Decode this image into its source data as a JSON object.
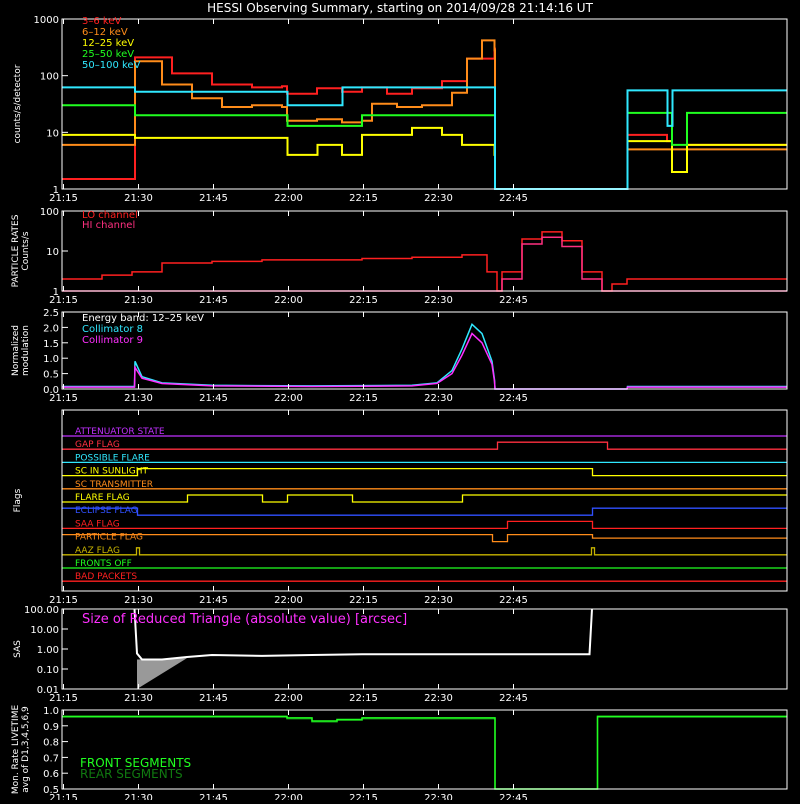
{
  "title": "HESSI Observing Summary, starting on 2014/09/28 21:14:16 UT",
  "time_ticks": [
    "21:15",
    "21:30",
    "21:45",
    "22:00",
    "22:15",
    "22:30",
    "22:45"
  ],
  "chart_data": [
    {
      "type": "line",
      "name": "count-rates",
      "ylabel": "counts/s/detector",
      "yscale": "log",
      "ylim": [
        1,
        1000
      ],
      "ytick_labels": [
        "1",
        "10",
        "100",
        "1000"
      ],
      "ytick_values": [
        1,
        10,
        100,
        1000
      ],
      "x_unit": "minutes after 21:15",
      "legend_placement": "top-left",
      "series": [
        {
          "name": "3–6 keV",
          "color": "#ff2020",
          "x": [
            0,
            14.5,
            14.6,
            22,
            30,
            38,
            44,
            45,
            51,
            56,
            60,
            65,
            70,
            76,
            81,
            86.5,
            86.6,
            113,
            113.1,
            121,
            122,
            125,
            145
          ],
          "values": [
            1.5,
            1.5,
            210,
            110,
            70,
            62,
            65,
            48,
            60,
            52,
            62,
            48,
            60,
            80,
            200,
            300,
            1,
            1,
            9,
            7,
            2,
            6,
            6
          ]
        },
        {
          "name": "6–12 keV",
          "color": "#ff8c1a",
          "x": [
            0,
            14.5,
            14.6,
            20,
            26,
            32,
            38,
            44,
            45,
            51,
            56,
            60,
            62,
            67,
            72,
            78,
            81,
            84,
            86.5,
            86.6,
            113,
            113.1,
            145
          ],
          "values": [
            6,
            6,
            180,
            70,
            40,
            28,
            30,
            28,
            16,
            17,
            15,
            16,
            32,
            28,
            30,
            50,
            200,
            420,
            280,
            1,
            1,
            5,
            5
          ]
        },
        {
          "name": "12–25 keV",
          "color": "#ffff00",
          "x": [
            0,
            14.5,
            14.6,
            45,
            45.1,
            51,
            51.1,
            56,
            60,
            65,
            70,
            76,
            80,
            86.5,
            86.6,
            113,
            113.1,
            121,
            122,
            125,
            145
          ],
          "values": [
            9,
            9,
            8,
            8,
            4,
            4,
            6,
            4,
            9,
            9,
            12,
            9,
            6,
            4,
            1,
            1,
            7,
            7,
            2,
            6,
            6
          ]
        },
        {
          "name": "25–50 keV",
          "color": "#20ff20",
          "x": [
            0,
            14.5,
            14.6,
            45,
            45.1,
            51,
            51.1,
            60,
            86.5,
            86.6,
            113,
            113.1,
            121,
            122,
            125,
            145
          ],
          "values": [
            30,
            30,
            20,
            20,
            13,
            13,
            13,
            20,
            20,
            1,
            1,
            22,
            22,
            6,
            22,
            22
          ]
        },
        {
          "name": "50–100 keV",
          "color": "#30e8ff",
          "x": [
            0,
            14.5,
            14.6,
            45,
            45.1,
            56,
            56.1,
            86.5,
            86.6,
            113,
            113.1,
            121,
            121.1,
            122,
            122.1,
            145
          ],
          "values": [
            62,
            62,
            52,
            52,
            30,
            30,
            62,
            62,
            1,
            1,
            55,
            55,
            13,
            13,
            55,
            55
          ]
        }
      ]
    },
    {
      "type": "line",
      "name": "particle-rates",
      "ylabel_lines": [
        "PARTICLE RATES",
        "Counts/s"
      ],
      "yscale": "log",
      "ylim": [
        1,
        100
      ],
      "ytick_labels": [
        "1",
        "10",
        "100"
      ],
      "ytick_values": [
        1,
        10,
        100
      ],
      "legend_placement": "top-left",
      "series": [
        {
          "name": "LO channel",
          "color": "#ff2020",
          "x": [
            0,
            8,
            14,
            20,
            30,
            40,
            50,
            60,
            70,
            80,
            85,
            87,
            88,
            92,
            96,
            100,
            104,
            108,
            110,
            113,
            120,
            130,
            145
          ],
          "values": [
            2,
            2.5,
            3,
            5,
            5.5,
            6,
            6,
            6.5,
            7,
            8,
            3,
            1,
            3,
            20,
            30,
            18,
            3,
            1,
            1.5,
            2,
            2,
            2,
            2
          ]
        },
        {
          "name": "HI channel",
          "color": "#ff3080",
          "x": [
            0,
            87,
            88,
            92,
            96,
            100,
            104,
            108,
            145
          ],
          "values": [
            1,
            1,
            2,
            15,
            22,
            13,
            2,
            1,
            1
          ]
        }
      ]
    },
    {
      "type": "line",
      "name": "modulation",
      "ylabel_lines": [
        "Normalized",
        "modulation"
      ],
      "ylim": [
        0,
        2.5
      ],
      "ytick_labels": [
        "0.0",
        "0.5",
        "1.0",
        "1.5",
        "2.0",
        "2.5"
      ],
      "ytick_values": [
        0,
        0.5,
        1.0,
        1.5,
        2.0,
        2.5
      ],
      "annotation": "Energy band: 12–25 keV",
      "legend_placement": "top-left",
      "series": [
        {
          "name": "Collimator 8",
          "color": "#30e8ff",
          "x": [
            0,
            14.5,
            14.6,
            16,
            20,
            30,
            50,
            70,
            75,
            78,
            80,
            82,
            84,
            86,
            86.5,
            86.6,
            113,
            113.1,
            145
          ],
          "values": [
            0.08,
            0.08,
            0.9,
            0.4,
            0.2,
            0.12,
            0.1,
            0.12,
            0.2,
            0.6,
            1.3,
            2.1,
            1.8,
            0.9,
            0.3,
            0,
            0,
            0.08,
            0.08
          ]
        },
        {
          "name": "Collimator 9",
          "color": "#ff30ff",
          "x": [
            0,
            14.5,
            14.6,
            16,
            20,
            30,
            50,
            70,
            75,
            78,
            80,
            82,
            84,
            86,
            86.5,
            86.6,
            113,
            113.1,
            145
          ],
          "values": [
            0.06,
            0.06,
            0.7,
            0.35,
            0.18,
            0.1,
            0.08,
            0.1,
            0.18,
            0.5,
            1.1,
            1.8,
            1.5,
            0.8,
            0.25,
            0,
            0,
            0.06,
            0.06
          ]
        }
      ]
    },
    {
      "type": "line",
      "name": "flags",
      "ylabel": "Flags",
      "series": [
        {
          "name": "ATTENUATOR STATE",
          "color": "#c030ff",
          "x": [
            0,
            145
          ],
          "values": [
            0,
            0
          ]
        },
        {
          "name": "GAP FLAG",
          "color": "#ff3040",
          "x": [
            0,
            87,
            87.1,
            109,
            109.1,
            145
          ],
          "values": [
            0,
            0,
            1,
            1,
            0,
            0
          ]
        },
        {
          "name": "POSSIBLE FLARE",
          "color": "#30e8ff",
          "x": [
            0,
            145
          ],
          "values": [
            0,
            0
          ]
        },
        {
          "name": "SC IN SUNLIGHT",
          "color": "#ffff00",
          "x": [
            0,
            15,
            15.1,
            106,
            106.1,
            145
          ],
          "values": [
            0,
            0,
            1,
            1,
            0,
            0
          ]
        },
        {
          "name": "SC TRANSMITTER",
          "color": "#ff8c1a",
          "x": [
            0,
            145
          ],
          "values": [
            0,
            0
          ]
        },
        {
          "name": "FLARE FLAG",
          "color": "#ffff00",
          "x": [
            0,
            25,
            25.1,
            40,
            40.1,
            45,
            45.1,
            58,
            58.1,
            80,
            80.1,
            145
          ],
          "values": [
            0,
            0,
            1,
            1,
            0,
            0,
            1,
            1,
            0,
            0,
            1,
            1
          ]
        },
        {
          "name": "ECLIPSE FLAG",
          "color": "#3050ff",
          "x": [
            0,
            15,
            15.1,
            106,
            106.1,
            145
          ],
          "values": [
            1,
            1,
            0,
            0,
            1,
            1
          ]
        },
        {
          "name": "SAA FLAG",
          "color": "#ff2020",
          "x": [
            0,
            89,
            89.1,
            106,
            106.1,
            145
          ],
          "values": [
            0,
            0,
            1,
            1,
            0,
            0
          ]
        },
        {
          "name": "PARTICLE FLAG",
          "color": "#ff8c1a",
          "x": [
            0,
            86,
            86.1,
            89,
            89.1,
            106,
            106.1,
            145
          ],
          "values": [
            1,
            1,
            0,
            0,
            1,
            1,
            0.5,
            0.5
          ]
        },
        {
          "name": "AAZ FLAG",
          "color": "#c8b400",
          "x": [
            0,
            14.8,
            14.9,
            15.4,
            15.5,
            105.8,
            105.9,
            106.4,
            106.5,
            145
          ],
          "values": [
            0,
            0,
            1,
            1,
            0,
            0,
            1,
            1,
            0,
            0
          ]
        },
        {
          "name": "FRONTS OFF",
          "color": "#20ff20",
          "x": [
            0,
            145
          ],
          "values": [
            0,
            0
          ]
        },
        {
          "name": "BAD PACKETS",
          "color": "#ff2020",
          "x": [
            0,
            145
          ],
          "values": [
            0,
            0
          ]
        }
      ]
    },
    {
      "type": "line",
      "name": "sas",
      "ylabel": "SAS",
      "title": "Size of Reduced Triangle (absolute value) [arcsec]",
      "yscale": "log",
      "ylim": [
        0.01,
        100
      ],
      "ytick_labels": [
        "0.01",
        "0.10",
        "1.00",
        "10.00",
        "100.00"
      ],
      "ytick_values": [
        0.01,
        0.1,
        1,
        10,
        100
      ],
      "series": [
        {
          "name": "SAS",
          "color": "#ffffff",
          "x": [
            14.5,
            15,
            16,
            20,
            25,
            30,
            40,
            50,
            60,
            70,
            80,
            90,
            100,
            105.5,
            106
          ],
          "values": [
            100,
            0.6,
            0.3,
            0.3,
            0.4,
            0.5,
            0.45,
            0.5,
            0.55,
            0.55,
            0.55,
            0.55,
            0.55,
            0.55,
            100
          ]
        }
      ]
    },
    {
      "type": "line",
      "name": "livetime",
      "ylabel_lines": [
        "Mon. Rate LIVETIME",
        "avg of D1,3,4,5,6,9"
      ],
      "ylim": [
        0.5,
        1.0
      ],
      "ytick_labels": [
        "0.5",
        "0.6",
        "0.7",
        "0.8",
        "0.9",
        "1.0"
      ],
      "ytick_values": [
        0.5,
        0.6,
        0.7,
        0.8,
        0.9,
        1.0
      ],
      "legend_placement": "bottom-left",
      "series": [
        {
          "name": "FRONT SEGMENTS",
          "color": "#20ff20",
          "x": [
            0,
            30,
            45,
            50,
            55,
            60,
            70,
            86.5,
            86.6,
            107,
            107.1,
            145
          ],
          "values": [
            0.96,
            0.96,
            0.95,
            0.93,
            0.94,
            0.95,
            0.95,
            0.95,
            0.5,
            0.5,
            0.96,
            0.96
          ]
        },
        {
          "name": "REAR SEGMENTS",
          "color": "#107a10",
          "x": [
            0,
            30,
            45,
            50,
            55,
            60,
            70,
            86.5,
            86.6,
            107,
            107.1,
            145
          ],
          "values": [
            0.955,
            0.955,
            0.945,
            0.925,
            0.935,
            0.945,
            0.945,
            0.945,
            0.5,
            0.5,
            0.955,
            0.955
          ]
        }
      ]
    }
  ]
}
